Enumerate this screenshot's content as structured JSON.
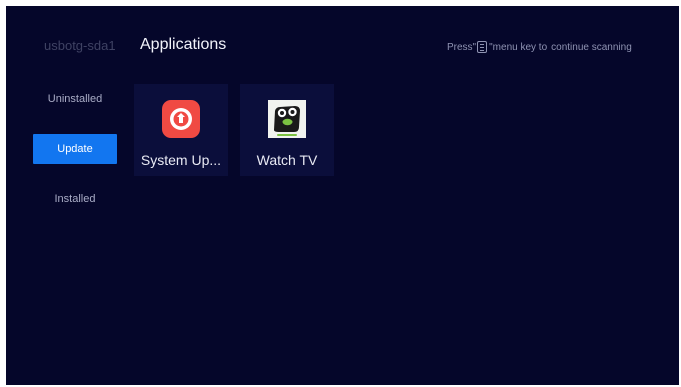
{
  "header": {
    "device": "usbotg-sda1",
    "title": "Applications",
    "hint_prefix": "Press\"",
    "hint_suffix": "\"menu key to",
    "hint_tail": "continue scanning"
  },
  "sidebar": {
    "items": [
      {
        "label": "Uninstalled",
        "active": false
      },
      {
        "label": "Update",
        "active": true
      },
      {
        "label": "Installed",
        "active": false
      }
    ]
  },
  "apps": [
    {
      "label": "System Up...",
      "icon": "system-update-icon",
      "icon_color": "#f04a43"
    },
    {
      "label": "Watch TV",
      "icon": "watch-tv-icon",
      "icon_color": "#f1f3ef"
    }
  ],
  "colors": {
    "background": "#05062a",
    "tile": "#0b0e3b",
    "accent": "#1276f0"
  }
}
